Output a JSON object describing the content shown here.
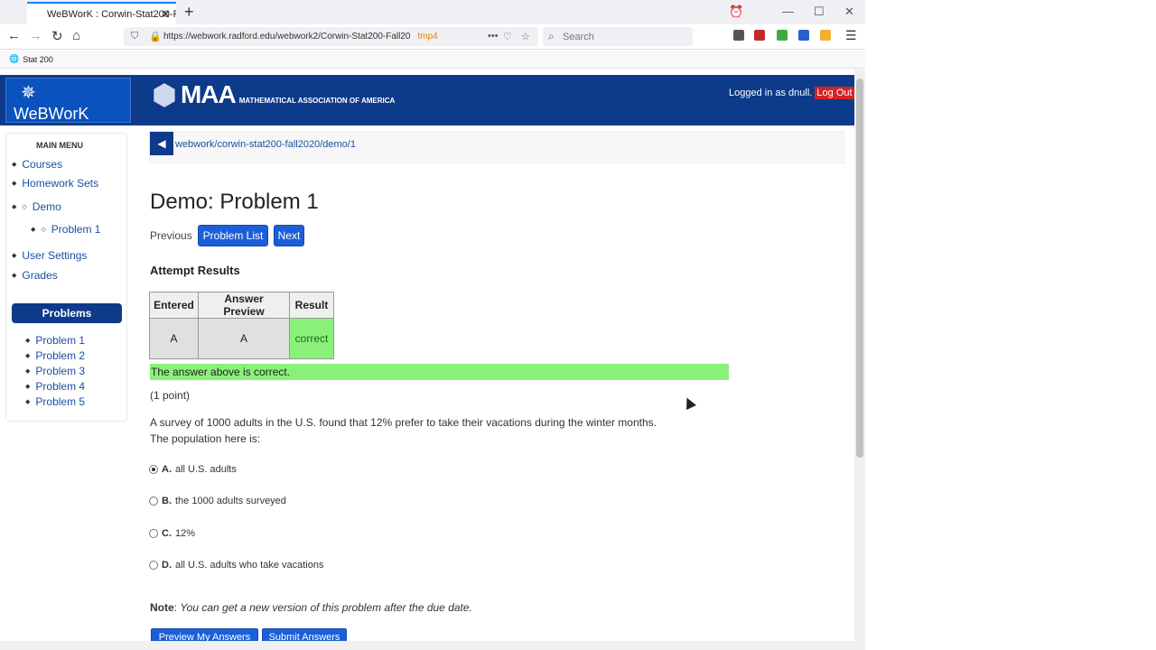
{
  "browser": {
    "tab_title": "WeBWorK : Corwin-Stat200-Fa",
    "url": "https://webwork.radford.edu/webwork2/Corwin-Stat200-Fall20",
    "url_suffix": "tmp4",
    "search_placeholder": "Search",
    "bookmark": "Stat 200"
  },
  "header": {
    "logo_text": "WeBWorK",
    "maa_big": "MAA",
    "maa_small": "MATHEMATICAL ASSOCIATION OF AMERICA",
    "logged_in": "Logged in as dnull.",
    "logout": "Log Out"
  },
  "sidebar": {
    "main_menu": "MAIN MENU",
    "links": [
      "Courses",
      "Homework Sets",
      "Demo",
      "Problem 1",
      "User Settings",
      "Grades"
    ],
    "problems_heading": "Problems",
    "problems": [
      "Problem 1",
      "Problem 2",
      "Problem 3",
      "Problem 4",
      "Problem 5"
    ]
  },
  "main": {
    "breadcrumb": "webwork/corwin-stat200-fall2020/demo/1",
    "title": "Demo: Problem 1",
    "previous": "Previous",
    "problem_list": "Problem List",
    "next": "Next",
    "attempt_results": "Attempt Results",
    "table": {
      "headers": [
        "Entered",
        "Answer Preview",
        "Result"
      ],
      "row": [
        "A",
        "A",
        "correct"
      ]
    },
    "correct_message": "The answer above is correct.",
    "points": "(1 point)",
    "question_line1": "A survey of 1000 adults in the U.S. found that 12% prefer to take their vacations during the winter months.",
    "question_line2": "The population here is:",
    "choices": [
      {
        "letter": "A.",
        "text": "all U.S. adults",
        "selected": true
      },
      {
        "letter": "B.",
        "text": "the 1000 adults surveyed",
        "selected": false
      },
      {
        "letter": "C.",
        "text": "12%",
        "selected": false
      },
      {
        "letter": "D.",
        "text": "all U.S. adults who take vacations",
        "selected": false
      }
    ],
    "note_label": "Note",
    "note_text": "You can get a new version of this problem after the due date.",
    "preview_button": "Preview My Answers",
    "submit_button": "Submit Answers"
  },
  "colors": {
    "masthead": "#0d3a8a",
    "button": "#1b5fd8",
    "correct": "#8af07a",
    "logout": "#d62222"
  }
}
